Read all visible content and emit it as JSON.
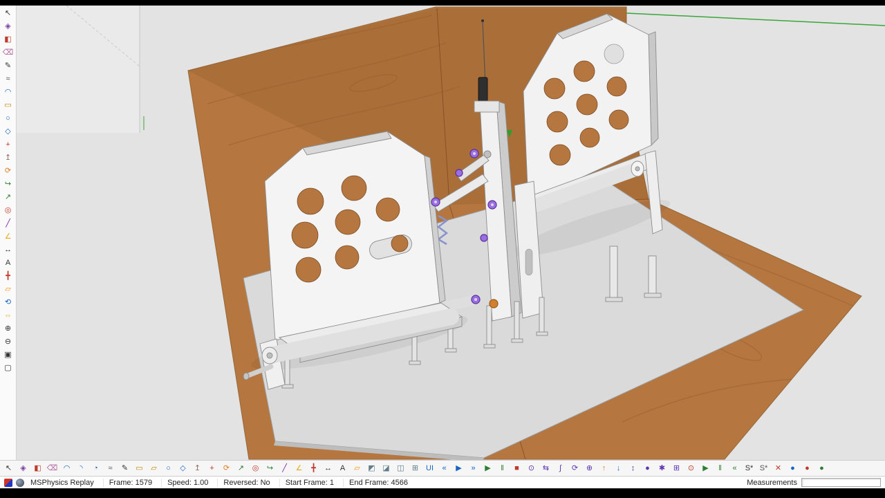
{
  "left_toolbar": {
    "tools": [
      {
        "name": "select-tool",
        "glyph": "↖",
        "color": "#333333"
      },
      {
        "name": "make-component-tool",
        "glyph": "◈",
        "color": "#7b3fa0"
      },
      {
        "name": "paint-bucket-tool",
        "glyph": "◧",
        "color": "#c0392b"
      },
      {
        "name": "eraser-tool",
        "glyph": "⌫",
        "color": "#b05f9a"
      },
      {
        "name": "line-tool",
        "glyph": "✎",
        "color": "#333333"
      },
      {
        "name": "freehand-tool",
        "glyph": "≈",
        "color": "#555555"
      },
      {
        "name": "arc-tool",
        "glyph": "◠",
        "color": "#1565c0"
      },
      {
        "name": "rectangle-tool",
        "glyph": "▭",
        "color": "#b8860b"
      },
      {
        "name": "circle-tool",
        "glyph": "○",
        "color": "#1565c0"
      },
      {
        "name": "polygon-tool",
        "glyph": "◇",
        "color": "#1565c0"
      },
      {
        "name": "move-tool",
        "glyph": "+",
        "color": "#c0392b"
      },
      {
        "name": "push-pull-tool",
        "glyph": "↥",
        "color": "#8d6e63"
      },
      {
        "name": "rotate-tool",
        "glyph": "⟳",
        "color": "#e67e22"
      },
      {
        "name": "follow-me-tool",
        "glyph": "↪",
        "color": "#2e7d32"
      },
      {
        "name": "scale-tool",
        "glyph": "↗",
        "color": "#2e7d32"
      },
      {
        "name": "offset-tool",
        "glyph": "◎",
        "color": "#c0392b"
      },
      {
        "name": "tape-measure-tool",
        "glyph": "╱",
        "color": "#7b1fa2"
      },
      {
        "name": "protractor-tool",
        "glyph": "∠",
        "color": "#e6a817"
      },
      {
        "name": "dimension-tool",
        "glyph": "↔",
        "color": "#333333"
      },
      {
        "name": "text-tool",
        "glyph": "A",
        "color": "#333333"
      },
      {
        "name": "axes-tool",
        "glyph": "╋",
        "color": "#c0392b"
      },
      {
        "name": "section-plane-tool",
        "glyph": "▱",
        "color": "#ff8f00"
      },
      {
        "name": "orbit-tool",
        "glyph": "⟲",
        "color": "#1565c0"
      },
      {
        "name": "pan-tool",
        "glyph": "⇔",
        "color": "#e6a817"
      },
      {
        "name": "zoom-in-tool",
        "glyph": "⊕",
        "color": "#333333"
      },
      {
        "name": "zoom-out-tool",
        "glyph": "⊖",
        "color": "#333333"
      },
      {
        "name": "zoom-window-tool",
        "glyph": "▣",
        "color": "#333333"
      },
      {
        "name": "zoom-extents-tool",
        "glyph": "▢",
        "color": "#333333"
      }
    ]
  },
  "bottom_toolbar": {
    "tools": [
      {
        "name": "select-tool",
        "glyph": "↖",
        "color": "#333333"
      },
      {
        "name": "make-component-tool",
        "glyph": "◈",
        "color": "#7b3fa0"
      },
      {
        "name": "paint-bucket-tool",
        "glyph": "◧",
        "color": "#c0392b"
      },
      {
        "name": "eraser-tool",
        "glyph": "⌫",
        "color": "#b05f9a"
      },
      {
        "name": "arc-2pt-tool",
        "glyph": "◠",
        "color": "#1565c0"
      },
      {
        "name": "arc-3pt-tool",
        "glyph": "◝",
        "color": "#1565c0"
      },
      {
        "name": "pie-tool",
        "glyph": "◔",
        "color": "#1565c0"
      },
      {
        "name": "freehand-tool",
        "glyph": "≈",
        "color": "#555555"
      },
      {
        "name": "line-tool",
        "glyph": "✎",
        "color": "#333333"
      },
      {
        "name": "rectangle-tool",
        "glyph": "▭",
        "color": "#b8860b"
      },
      {
        "name": "rotated-rectangle-tool",
        "glyph": "▱",
        "color": "#b8860b"
      },
      {
        "name": "circle-tool",
        "glyph": "○",
        "color": "#1565c0"
      },
      {
        "name": "polygon-tool",
        "glyph": "◇",
        "color": "#1565c0"
      },
      {
        "name": "push-pull-tool",
        "glyph": "↥",
        "color": "#8d6e63"
      },
      {
        "name": "move-tool",
        "glyph": "+",
        "color": "#c0392b"
      },
      {
        "name": "rotate-tool",
        "glyph": "⟳",
        "color": "#e67e22"
      },
      {
        "name": "scale-tool",
        "glyph": "↗",
        "color": "#2e7d32"
      },
      {
        "name": "offset-tool",
        "glyph": "◎",
        "color": "#c0392b"
      },
      {
        "name": "follow-me-tool",
        "glyph": "↪",
        "color": "#2e7d32"
      },
      {
        "name": "tape-measure-tool",
        "glyph": "╱",
        "color": "#7b1fa2"
      },
      {
        "name": "protractor-tool",
        "glyph": "∠",
        "color": "#e6a817"
      },
      {
        "name": "axes-tool",
        "glyph": "╋",
        "color": "#c0392b"
      },
      {
        "name": "dimension-tool",
        "glyph": "↔",
        "color": "#333333"
      },
      {
        "name": "text-tool",
        "glyph": "A",
        "color": "#333333"
      },
      {
        "name": "section-plane-tool",
        "glyph": "▱",
        "color": "#ff8f00"
      },
      {
        "name": "solid-union-tool",
        "glyph": "◩",
        "color": "#607d8b"
      },
      {
        "name": "solid-subtract-tool",
        "glyph": "◪",
        "color": "#607d8b"
      },
      {
        "name": "solid-trim-tool",
        "glyph": "◫",
        "color": "#607d8b"
      },
      {
        "name": "solid-intersect-tool",
        "glyph": "⊞",
        "color": "#607d8b"
      },
      {
        "name": "msphysics-ui-button",
        "glyph": "UI",
        "color": "#1565c0"
      },
      {
        "name": "replay-rewind-button",
        "glyph": "«",
        "color": "#1565c0"
      },
      {
        "name": "replay-play-button",
        "glyph": "▶",
        "color": "#1565c0"
      },
      {
        "name": "replay-forward-button",
        "glyph": "»",
        "color": "#1565c0"
      },
      {
        "name": "simulation-play-button",
        "glyph": "▶",
        "color": "#2e7d32"
      },
      {
        "name": "simulation-pause-button",
        "glyph": "‖",
        "color": "#2e7d32"
      },
      {
        "name": "simulation-stop-button",
        "glyph": "■",
        "color": "#c0392b"
      },
      {
        "name": "joint-connect-tool",
        "glyph": "⊙",
        "color": "#5e35b1"
      },
      {
        "name": "joint-slider-tool",
        "glyph": "⇆",
        "color": "#5e35b1"
      },
      {
        "name": "joint-spring-tool",
        "glyph": "∫",
        "color": "#5e35b1"
      },
      {
        "name": "joint-motor-tool",
        "glyph": "⟳",
        "color": "#5e35b1"
      },
      {
        "name": "joint-servo-tool",
        "glyph": "⊕",
        "color": "#5e35b1"
      },
      {
        "name": "force-up-tool",
        "glyph": "↑",
        "color": "#e67e22"
      },
      {
        "name": "force-down-tool",
        "glyph": "↓",
        "color": "#1565c0"
      },
      {
        "name": "joint-corkscrew-tool",
        "glyph": "↕",
        "color": "#5e35b1"
      },
      {
        "name": "joint-ball-tool",
        "glyph": "●",
        "color": "#5e35b1"
      },
      {
        "name": "joint-universal-tool",
        "glyph": "✱",
        "color": "#5e35b1"
      },
      {
        "name": "joint-fixed-tool",
        "glyph": "⊞",
        "color": "#5e35b1"
      },
      {
        "name": "record-button",
        "glyph": "⊙",
        "color": "#c0392b"
      },
      {
        "name": "anim-play-button",
        "glyph": "▶",
        "color": "#2e7d32"
      },
      {
        "name": "anim-pause-button",
        "glyph": "‖",
        "color": "#2e7d32"
      },
      {
        "name": "anim-rewind-button",
        "glyph": "«",
        "color": "#2e7d32"
      },
      {
        "name": "add-scene-button",
        "glyph": "S*",
        "color": "#333333"
      },
      {
        "name": "update-scene-button",
        "glyph": "S*",
        "color": "#555555"
      },
      {
        "name": "delete-scene-button",
        "glyph": "✕",
        "color": "#c0392b"
      },
      {
        "name": "physics-body-blue-button",
        "glyph": "●",
        "color": "#1565c0"
      },
      {
        "name": "physics-body-red-button",
        "glyph": "●",
        "color": "#c0392b"
      },
      {
        "name": "physics-body-green-button",
        "glyph": "●",
        "color": "#2e7d32"
      }
    ]
  },
  "status_bar": {
    "segments": [
      "MSPhysics Replay",
      "Frame: 1579",
      "Speed: 1.00",
      "Reversed: No",
      "Start Frame: 1",
      "End Frame: 4566"
    ],
    "measurements_label": "Measurements",
    "measurements_value": "",
    "icons": [
      "msphysics-icon",
      "globe-icon"
    ]
  },
  "scene": {
    "description": "SketchUp 3D viewport: two white sim-pedal assemblies with hole-pattern side plates, linkages, springs and purple bolts, mounted on a gray baseplate over a plywood floor and wall",
    "colors": {
      "bg": "#e3e3e3",
      "wood": "#b5763f",
      "wood-dark": "#8f5a2c",
      "axis": "#3aa53a",
      "accent-purple": "#9a6fe0",
      "accent-orange": "#d08030"
    }
  }
}
